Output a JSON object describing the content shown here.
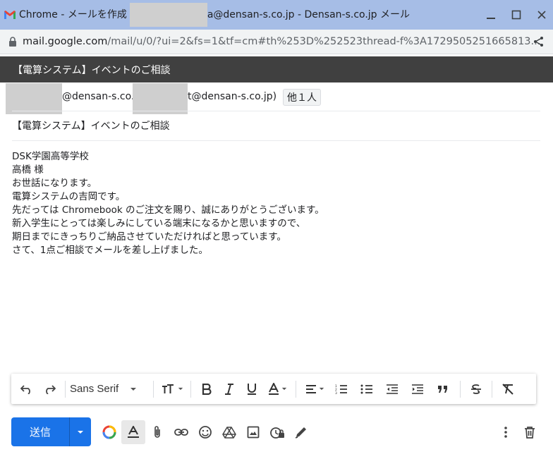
{
  "window": {
    "title_prefix": "Chrome - メールを作成 - ",
    "title_suffix": "a@densan-s.co.jp - Densan-s.co.jp メール",
    "minimize_glyph": "_",
    "maximize_glyph": "☐",
    "close_glyph": "✕"
  },
  "address_bar": {
    "domain": "mail.google.com",
    "path": "/mail/u/0/?ui=2&fs=1&tf=cm#th%253D%252523thread-f%3A1729505251665813..."
  },
  "compose": {
    "header_title": "【電算システム】イベントのご相談",
    "recipients": {
      "to_part1": "@densan-s.co.j",
      "to_part2": "t@densan-s.co.jp)",
      "others": "他１人"
    },
    "subject": "【電算システム】イベントのご相談",
    "body_lines": [
      "DSK学園高等学校",
      "高橋 様",
      "",
      "",
      "お世話になります。",
      "電算システムの吉岡です。",
      "",
      "先だっては Chromebook のご注文を賜り、誠にありがとうございます。",
      "新入学生にとっては楽しみにしている端末になるかと思いますので、",
      "期日までにきっちりご納品させていただければと思っています。",
      "",
      "さて、1点ご相談でメールを差し上げました。"
    ]
  },
  "toolbar": {
    "font_name": "Sans Serif"
  },
  "bottom": {
    "send_label": "送信"
  }
}
